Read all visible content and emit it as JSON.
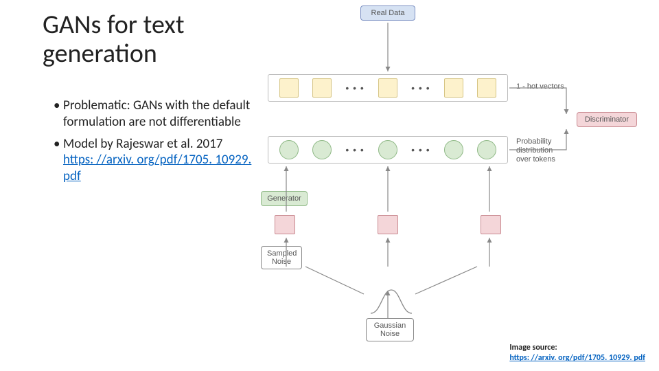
{
  "title_line1": "GANs for text",
  "title_line2": "generation",
  "bullets": {
    "b1": "Problematic: GANs with the default formulation are not differentiable",
    "b2_text": "Model by Rajeswar et al. 2017",
    "b2_link": "https: //arxiv. org/pdf/1705. 10929. pdf"
  },
  "diagram": {
    "real_data": "Real Data",
    "discriminator": "Discriminator",
    "generator": "Generator",
    "sampled_noise": "Sampled Noise",
    "gaussian_noise": "Gaussian Noise",
    "one_hot": "1 - hot vectors",
    "prob_dist_l1": "Probability",
    "prob_dist_l2": "distribution",
    "prob_dist_l3": "over tokens",
    "dots": "• • •"
  },
  "image_source": {
    "label": "Image source:",
    "link": "https: //arxiv. org/pdf/1705. 10929. pdf"
  }
}
